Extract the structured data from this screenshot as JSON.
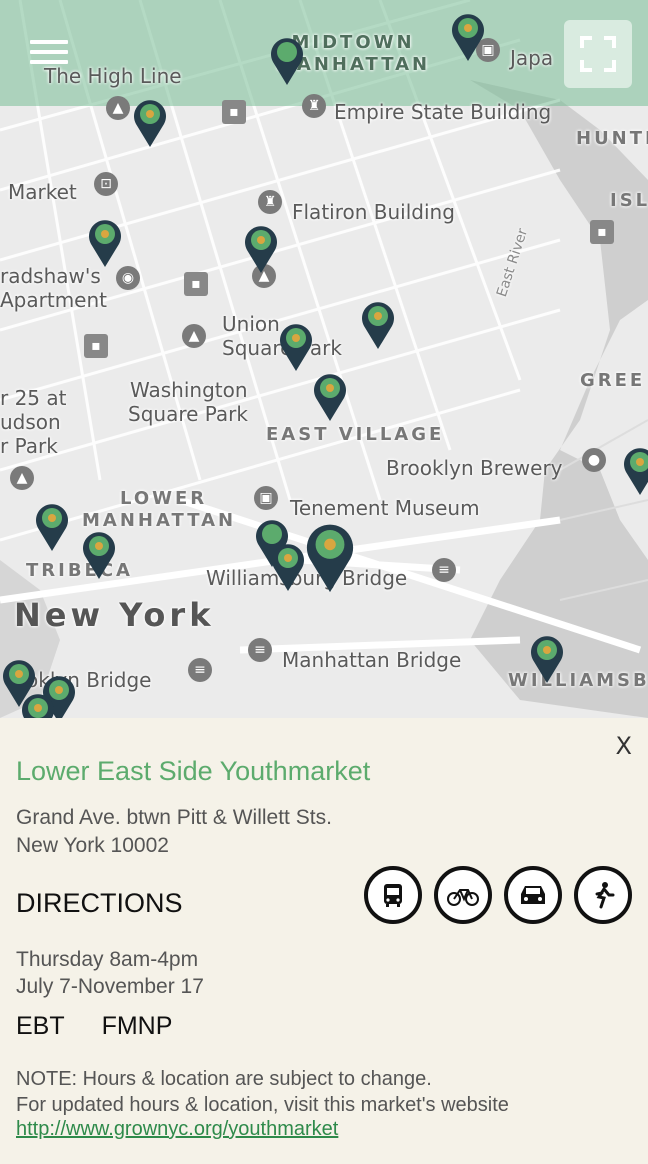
{
  "map": {
    "labels": {
      "midtown": "MIDTOWN\nMANHATTAN",
      "high_line": "The High Line",
      "japan": "Japa",
      "empire_state": "Empire State Building",
      "hunters": "HUNTE",
      "market": "Market",
      "isl": "ISL",
      "flatiron": "Flatiron Building",
      "east_river": "East River",
      "bradshaw_1": "radshaw's",
      "bradshaw_2": "Apartment",
      "union_sq_1": "Union",
      "union_sq_2": "Square Park",
      "greenpoint": "GREE",
      "washington_1": "Washington",
      "washington_2": "Square Park",
      "east_village": "EAST VILLAGE",
      "pier_1": "r 25 at",
      "pier_2": "udson",
      "pier_3": "r Park",
      "brooklyn_brewery": "Brooklyn Brewery",
      "lower_1": "LOWER",
      "lower_2": "MANHATTAN",
      "tenement": "Tenement Museum",
      "tribeca": "TRIBECA",
      "williamsburg_bridge": "Williamsburg Bridge",
      "new_york": "New York",
      "manhattan_bridge": "Manhattan Bridge",
      "brooklyn_bridge": "oklyn Bridge",
      "williamsburg": "WILLIAMSB"
    },
    "icons": {
      "menu": "hamburger-menu-icon",
      "fullscreen": "fullscreen-icon"
    },
    "colors": {
      "pin_outer": "#253c4a",
      "pin_inner_green": "#5cab6d",
      "pin_inner_yellow": "#d9a640",
      "topbar": "#78be96"
    }
  },
  "panel": {
    "close_label": "X",
    "market_name": "Lower East Side Youthmarket",
    "address_line1": "Grand Ave. btwn Pitt & Willett Sts.",
    "address_line2": "New York  10002",
    "directions_label": "DIRECTIONS",
    "direction_modes": [
      "bus-icon",
      "bike-icon",
      "car-icon",
      "walk-icon"
    ],
    "hours_line1": "Thursday 8am-4pm",
    "hours_line2": "July 7-November 17",
    "payment_1": "EBT",
    "payment_2": "FMNP",
    "note_line1": "NOTE: Hours & location are subject to change.",
    "note_line2": "For updated hours & location, visit this market's website",
    "note_link": "http://www.grownyc.org/youthmarket",
    "accent_color": "#5cab6d"
  }
}
